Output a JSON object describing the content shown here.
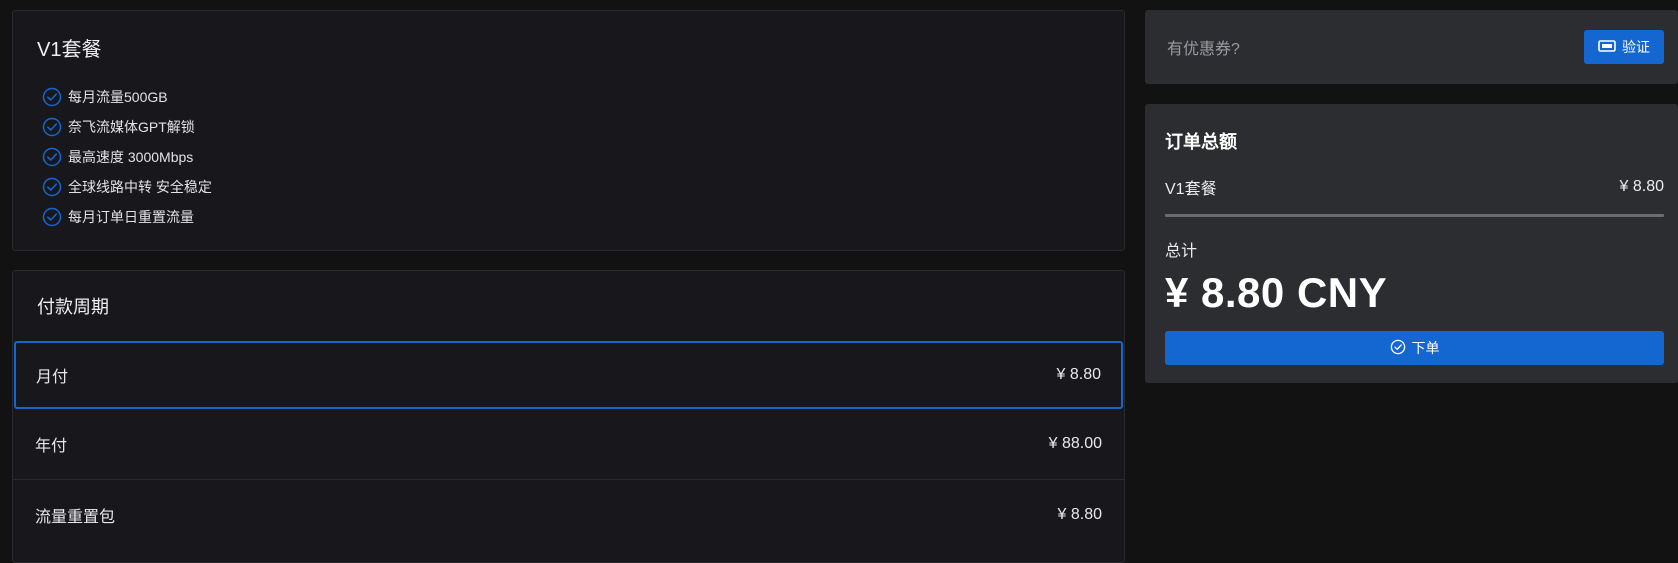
{
  "plan": {
    "title": "V1套餐",
    "features": [
      "每月流量500GB",
      "奈飞流媒体GPT解锁",
      "最高速度 3000Mbps",
      "全球线路中转 安全稳定",
      "每月订单日重置流量"
    ]
  },
  "period": {
    "title": "付款周期",
    "options": [
      {
        "label": "月付",
        "price": "¥ 8.80",
        "selected": true
      },
      {
        "label": "年付",
        "price": "¥ 88.00",
        "selected": false
      },
      {
        "label": "流量重置包",
        "price": "¥ 8.80",
        "selected": false
      }
    ]
  },
  "coupon": {
    "label": "有优惠券?",
    "verify_button": "验证",
    "icon": "ticket-icon"
  },
  "summary": {
    "title": "订单总额",
    "item_name": "V1套餐",
    "item_price": "¥ 8.80",
    "total_label": "总计",
    "total_amount": "¥ 8.80 CNY",
    "order_button": "下单",
    "order_icon": "check-circle-icon"
  },
  "colors": {
    "accent": "#1466d0",
    "page_bg": "#121212",
    "card_bg": "#18181c",
    "panel_bg": "#2c2d31"
  }
}
